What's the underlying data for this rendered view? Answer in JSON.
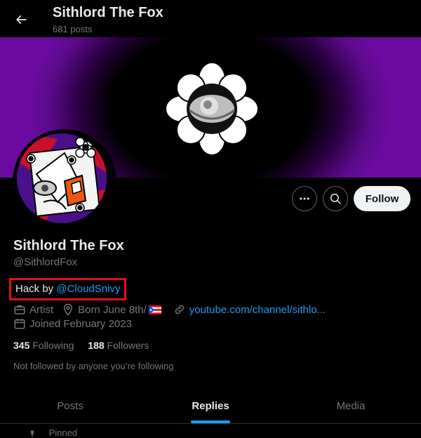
{
  "header": {
    "title": "Sithlord The Fox",
    "posts_count": "681 posts"
  },
  "actions": {
    "follow_label": "Follow"
  },
  "profile": {
    "display_name": "Sithlord The Fox",
    "handle": "@SithlordFox",
    "bio_prefix": "Hack by ",
    "bio_mention": "@CloudSnivy",
    "profession": "Artist",
    "birthday": "Born June 8th/",
    "website": "youtube.com/channel/sithlo...",
    "joined": "Joined February 2023",
    "following_count": "345",
    "following_label": "Following",
    "followers_count": "188",
    "followers_label": "Followers",
    "not_followed_text": "Not followed by anyone you’re following"
  },
  "tabs": [
    {
      "label": "Posts",
      "active": false
    },
    {
      "label": "Replies",
      "active": true
    },
    {
      "label": "Media",
      "active": false
    }
  ],
  "pinned_label": "Pinned",
  "colors": {
    "accent": "#1d9bf0",
    "banner_purple": "#6a0aa0",
    "highlight_box": "#e0101a"
  },
  "icons": [
    "back-arrow-icon",
    "more-icon",
    "search-icon",
    "briefcase-icon",
    "location-icon",
    "flag-icon",
    "link-icon",
    "calendar-icon",
    "pin-icon"
  ]
}
